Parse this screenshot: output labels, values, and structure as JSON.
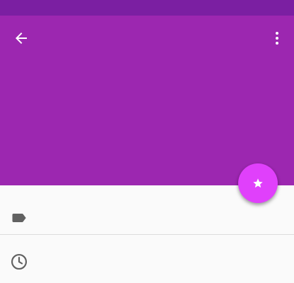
{
  "colors": {
    "status_bar": "#7b1fa2",
    "app_bar": "#9c27b0",
    "fab": "#e040fb",
    "icon_light": "#ffffff",
    "icon_dark": "#616161",
    "divider": "#dcdcdc"
  },
  "app_bar": {
    "back_icon": "arrow-back-icon",
    "overflow_icon": "more-vert-icon"
  },
  "fab": {
    "icon": "star-icon"
  },
  "list": {
    "items": [
      {
        "icon": "label-icon",
        "text": ""
      },
      {
        "icon": "clock-icon",
        "text": ""
      }
    ]
  }
}
